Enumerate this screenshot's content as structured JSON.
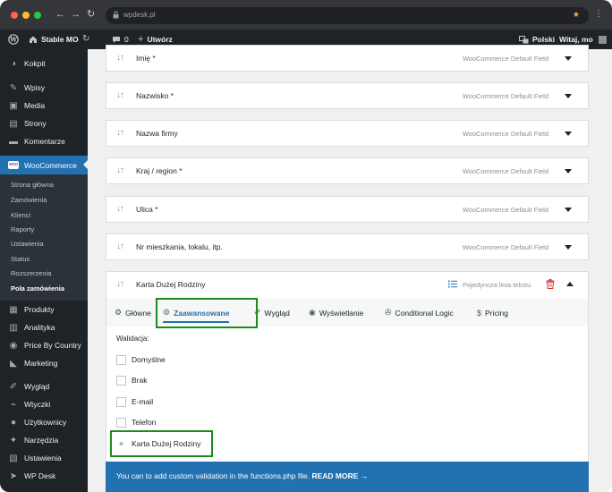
{
  "browser": {
    "url": "wpdesk.pl",
    "back_glyph": "←",
    "forward_glyph": "→",
    "reload_glyph": "↻",
    "star_glyph": "★",
    "menu_glyph": "⋮"
  },
  "adminbar": {
    "site_name": "Stable MO",
    "comments_count": "0",
    "new_label": "Utwórz",
    "language": "Polski",
    "greeting": "Witaj, mo"
  },
  "sidebar": {
    "items": [
      {
        "label": "Kokpit",
        "icon": "dashboard-icon",
        "glyph": "◑"
      },
      {
        "label": "Wpisy",
        "icon": "pin-icon",
        "glyph": "✎"
      },
      {
        "label": "Media",
        "icon": "media-icon",
        "glyph": "▣"
      },
      {
        "label": "Strony",
        "icon": "pages-icon",
        "glyph": "▤"
      },
      {
        "label": "Komentarze",
        "icon": "comments-icon",
        "glyph": "▬"
      },
      {
        "label": "WooCommerce",
        "icon": "woocommerce-icon",
        "glyph": "woo"
      },
      {
        "label": "Produkty",
        "icon": "products-icon",
        "glyph": "▦"
      },
      {
        "label": "Analityka",
        "icon": "analytics-icon",
        "glyph": "▥"
      },
      {
        "label": "Price By Country",
        "icon": "globe-icon",
        "glyph": "◉"
      },
      {
        "label": "Marketing",
        "icon": "megaphone-icon",
        "glyph": "◣"
      },
      {
        "label": "Wygląd",
        "icon": "appearance-icon",
        "glyph": "✐"
      },
      {
        "label": "Wtyczki",
        "icon": "plugins-icon",
        "glyph": "⌁"
      },
      {
        "label": "Użytkownicy",
        "icon": "users-icon",
        "glyph": "●"
      },
      {
        "label": "Narzędzia",
        "icon": "tools-icon",
        "glyph": "✦"
      },
      {
        "label": "Ustawienia",
        "icon": "settings-icon",
        "glyph": "▧"
      },
      {
        "label": "WP Desk",
        "icon": "wpdesk-icon",
        "glyph": "➤"
      }
    ],
    "submenu": [
      "Strona główna",
      "Zamówienia",
      "Klienci",
      "Raporty",
      "Ustawienia",
      "Status",
      "Rozszerzenia",
      "Pola zamówienia"
    ]
  },
  "fields": [
    {
      "name": "Imię *",
      "type": "WooCommerce Default Field"
    },
    {
      "name": "Nazwisko *",
      "type": "WooCommerce Default Field"
    },
    {
      "name": "Nazwa firmy",
      "type": "WooCommerce Default Field"
    },
    {
      "name": "Kraj / region *",
      "type": "WooCommerce Default Field"
    },
    {
      "name": "Ulica *",
      "type": "WooCommerce Default Field"
    },
    {
      "name": "Nr mieszkania, lokalu, itp.",
      "type": "WooCommerce Default Field"
    }
  ],
  "expanded_field": {
    "name": "Karta Dużej Rodziny",
    "type": "Pojedyncza linia tekstu",
    "tabs": [
      {
        "label": "Główne",
        "icon": "gear-icon",
        "glyph": "⚙"
      },
      {
        "label": "Zaawansowane",
        "icon": "gears-icon",
        "glyph": "⚙"
      },
      {
        "label": "Wygląd",
        "icon": "brush-icon",
        "glyph": "✐"
      },
      {
        "label": "Wyświetlanie",
        "icon": "eye-icon",
        "glyph": "◉"
      },
      {
        "label": "Conditional Logic",
        "icon": "wrench-icon",
        "glyph": "✇"
      },
      {
        "label": "Pricing",
        "icon": "dollar-icon",
        "glyph": "$"
      }
    ],
    "validation_label": "Walidacja:",
    "options": [
      {
        "label": "Domyślne",
        "checked": false
      },
      {
        "label": "Brak",
        "checked": false
      },
      {
        "label": "E-mail",
        "checked": false
      },
      {
        "label": "Telefon",
        "checked": false
      },
      {
        "label": "Karta Dużej Rodziny",
        "checked": true
      }
    ],
    "check_glyph": "×"
  },
  "notice": {
    "text": "You can to add custom validation in the functions.php file.",
    "link": "READ MORE →"
  },
  "colors": {
    "accent": "#2271b1",
    "highlight": "#1c8a1c",
    "sidebar": "#1d2327"
  }
}
